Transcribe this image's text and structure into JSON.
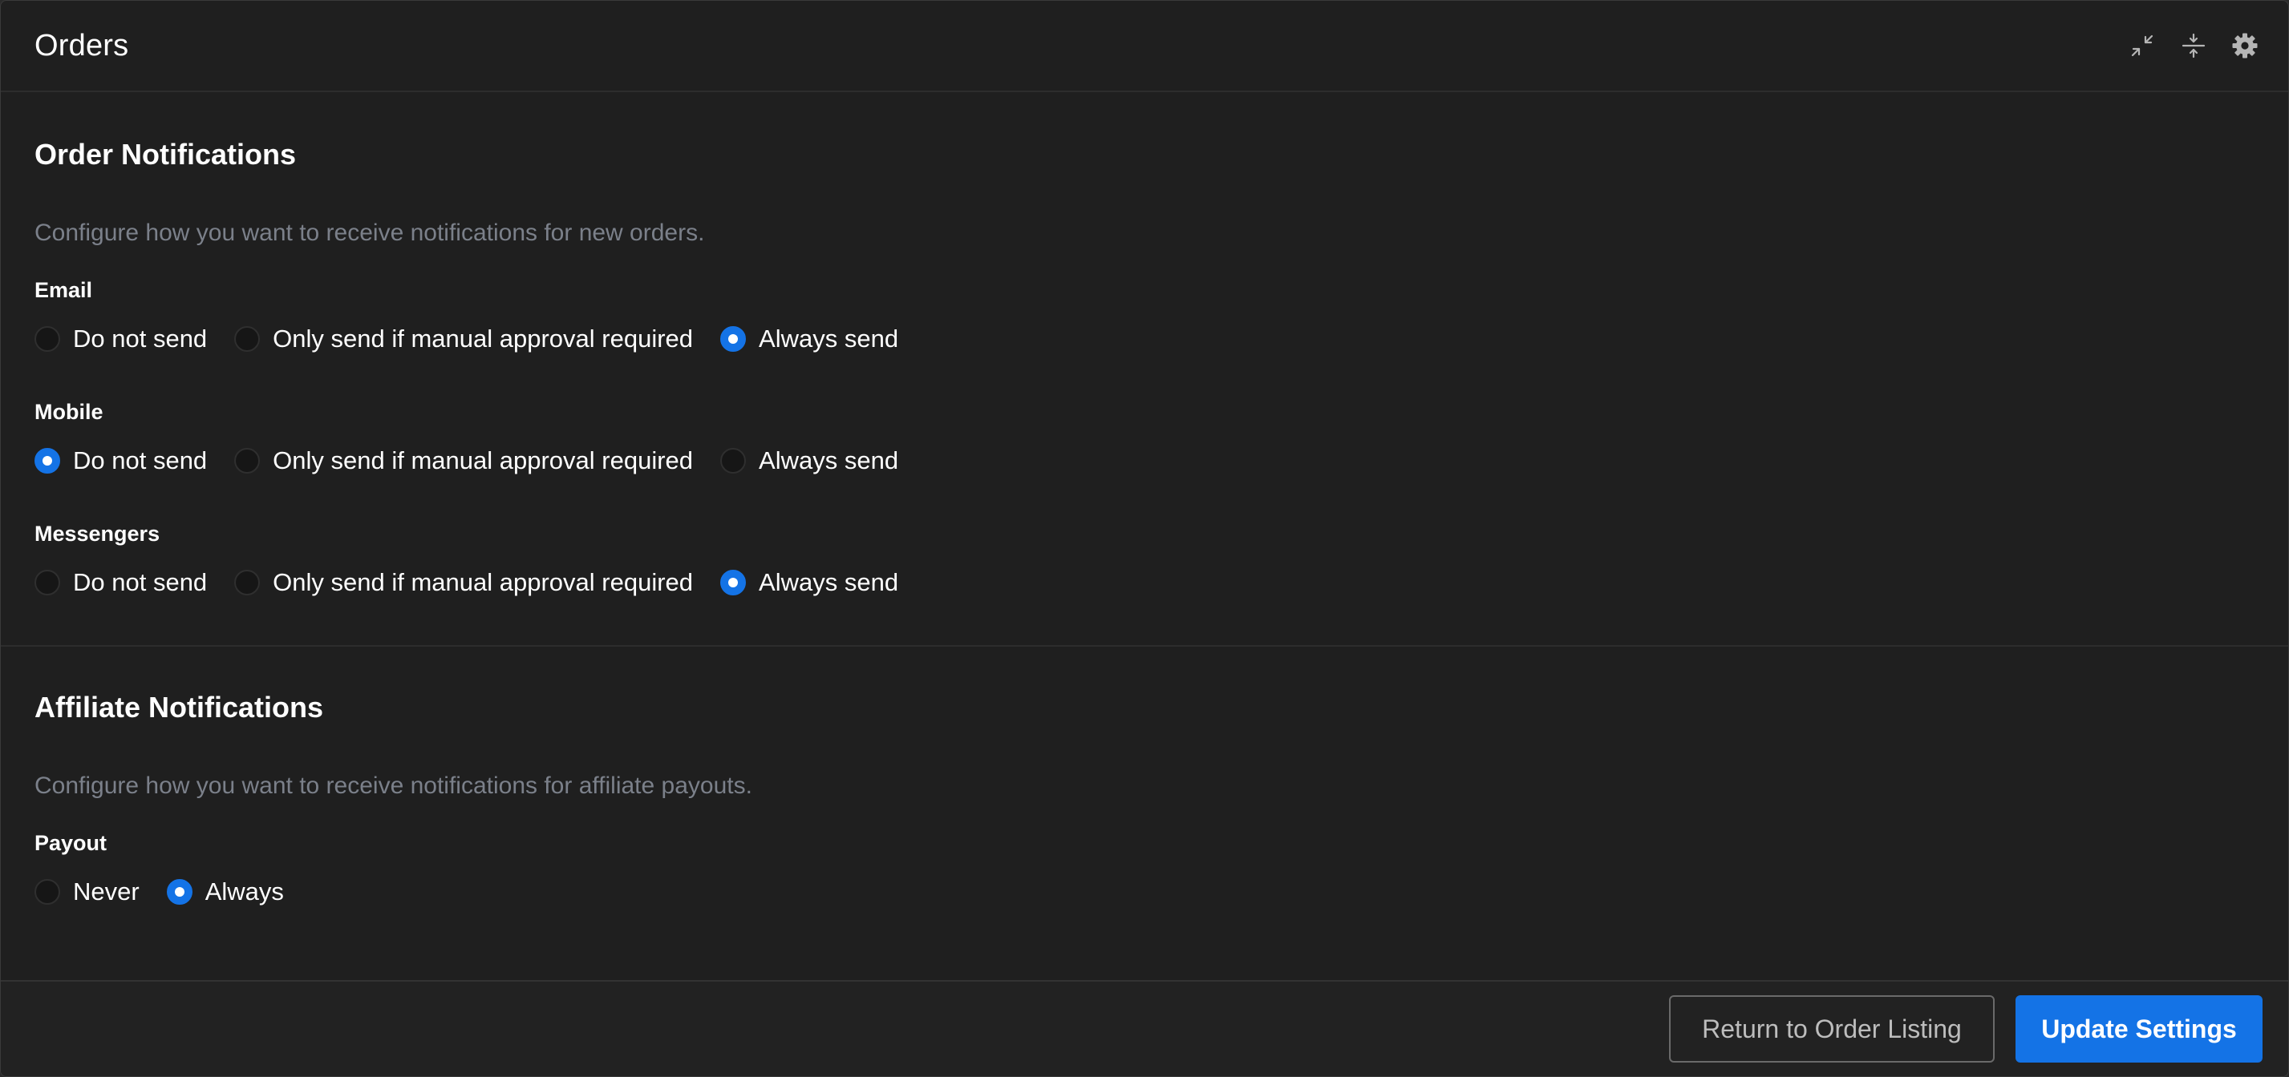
{
  "header": {
    "title": "Orders"
  },
  "order_notifications": {
    "title": "Order Notifications",
    "description": "Configure how you want to receive notifications for new orders.",
    "groups": [
      {
        "label": "Email",
        "options": [
          "Do not send",
          "Only send if manual approval required",
          "Always send"
        ],
        "selected": "Always send"
      },
      {
        "label": "Mobile",
        "options": [
          "Do not send",
          "Only send if manual approval required",
          "Always send"
        ],
        "selected": "Do not send"
      },
      {
        "label": "Messengers",
        "options": [
          "Do not send",
          "Only send if manual approval required",
          "Always send"
        ],
        "selected": "Always send"
      }
    ]
  },
  "affiliate_notifications": {
    "title": "Affiliate Notifications",
    "description": "Configure how you want to receive notifications for affiliate payouts.",
    "groups": [
      {
        "label": "Payout",
        "options": [
          "Never",
          "Always"
        ],
        "selected": "Always"
      }
    ]
  },
  "footer": {
    "return_label": "Return to Order Listing",
    "update_label": "Update Settings"
  },
  "colors": {
    "accent": "#1473e6",
    "background": "#1f1f1f",
    "muted_text": "#7b808a"
  },
  "icons": {
    "minimize": "collapse-arrows-icon",
    "collapse": "collapse-vertical-icon",
    "settings": "gear-icon"
  }
}
